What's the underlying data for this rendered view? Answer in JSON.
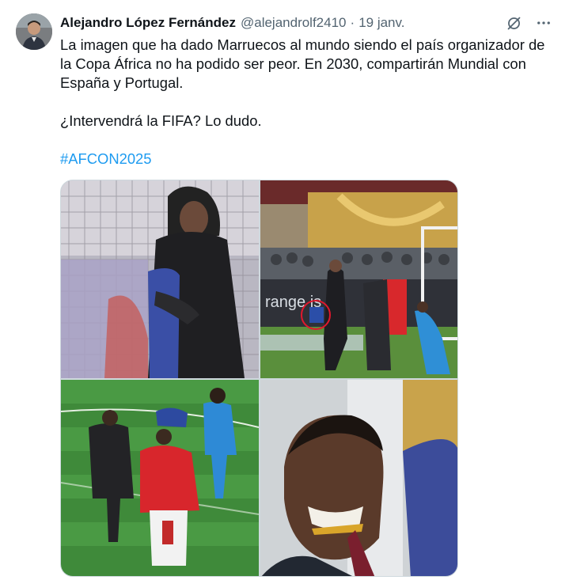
{
  "tweet": {
    "author_name": "Alejandro López Fernández",
    "handle": "@alejandrolf2410",
    "separator": "·",
    "date": "19 janv.",
    "paragraphs": [
      "La imagen que ha dado Marruecos al mundo siendo el país organizador de la Copa África no ha podido ser peor. En 2030, compartirán Mundial con España y Portugal.",
      "¿Intervendrá la FIFA? Lo dudo."
    ],
    "hashtag": "#AFCON2025",
    "more_icon": "more-icon",
    "grok_icon": "grok-icon"
  },
  "media": {
    "photo2_banner": "range is h",
    "colors": {
      "accent": "#1d9bf0",
      "muted": "#536471",
      "border": "#cfd9de",
      "pitch": "#3f8a3a",
      "highlight_circle": "#e0182d"
    }
  }
}
